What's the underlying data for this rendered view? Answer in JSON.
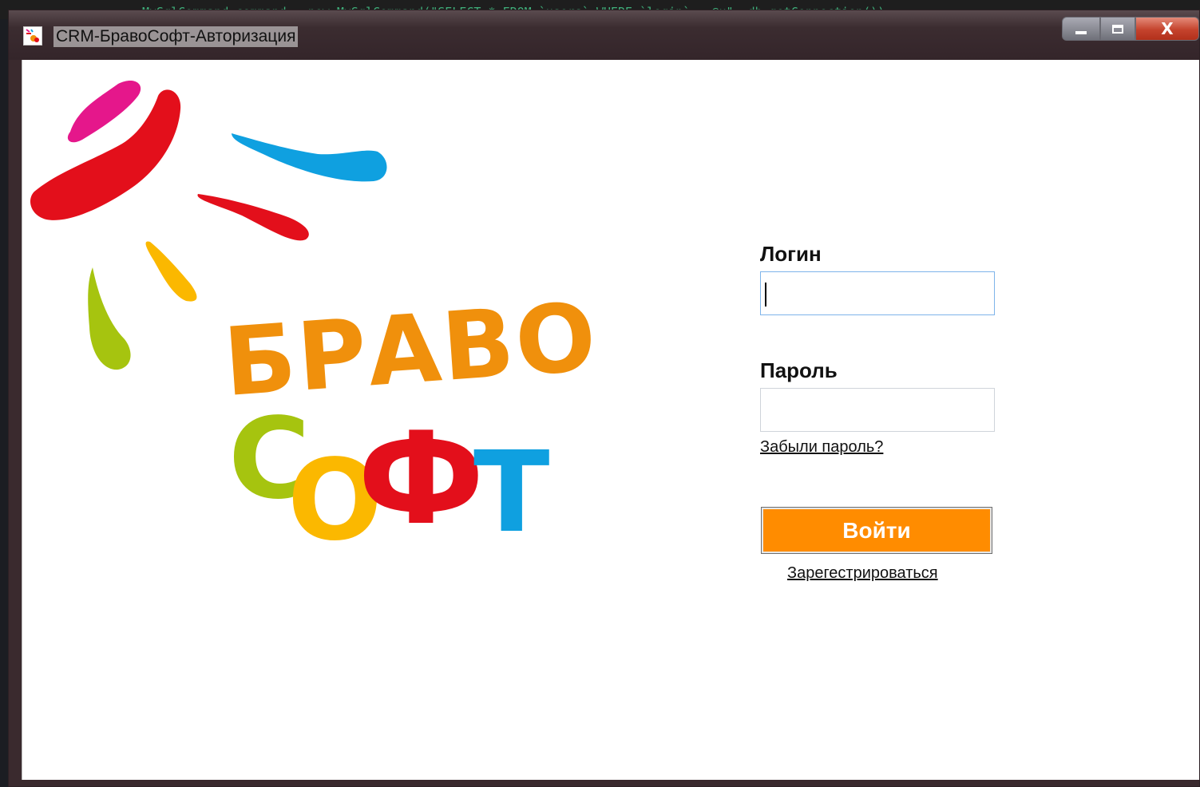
{
  "background": {
    "code_text": "MySqlCommand command = new MySqlCommand(\"SELECT * FROM `users` WHERE `login` = @u\", db.getConnection());"
  },
  "window": {
    "title": "CRM-БравоСофт-Авторизация",
    "controls": {
      "close_glyph": "X"
    }
  },
  "logo": {
    "word1": "БРАВО",
    "word2_letters": [
      "С",
      "О",
      "Ф",
      "Т"
    ],
    "colors": {
      "pink": "#e5178b",
      "red": "#e30f1b",
      "blue": "#0fa0e0",
      "yellow": "#fbb800",
      "green": "#a6c40f",
      "orange": "#f0900c"
    }
  },
  "form": {
    "login_label": "Логин",
    "login_value": "",
    "password_label": "Пароль",
    "password_value": "",
    "forgot_link": "Забыли пароль?",
    "submit_label": "Войти",
    "register_link": "Зарегестрироваться",
    "accent": "#ff8c00"
  }
}
